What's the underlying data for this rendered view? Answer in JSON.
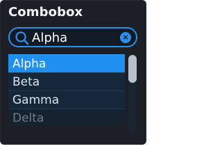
{
  "combobox": {
    "title": "Combobox",
    "search": {
      "value": "Alpha",
      "placeholder": ""
    },
    "clear_icon": "×",
    "options": [
      {
        "label": "Alpha",
        "selected": true
      },
      {
        "label": "Beta",
        "selected": false
      },
      {
        "label": "Gamma",
        "selected": false
      },
      {
        "label": "Delta",
        "selected": false
      }
    ],
    "scroll_position": 0
  },
  "colors": {
    "panel_bg": "#1c2026",
    "accent": "#2f8ee8",
    "selected_bg": "#1f8ff0",
    "option_bg": "#16273a",
    "scroll_thumb": "#b9c2cc"
  },
  "icons": {
    "search": "search-icon",
    "clear": "clear-icon"
  }
}
